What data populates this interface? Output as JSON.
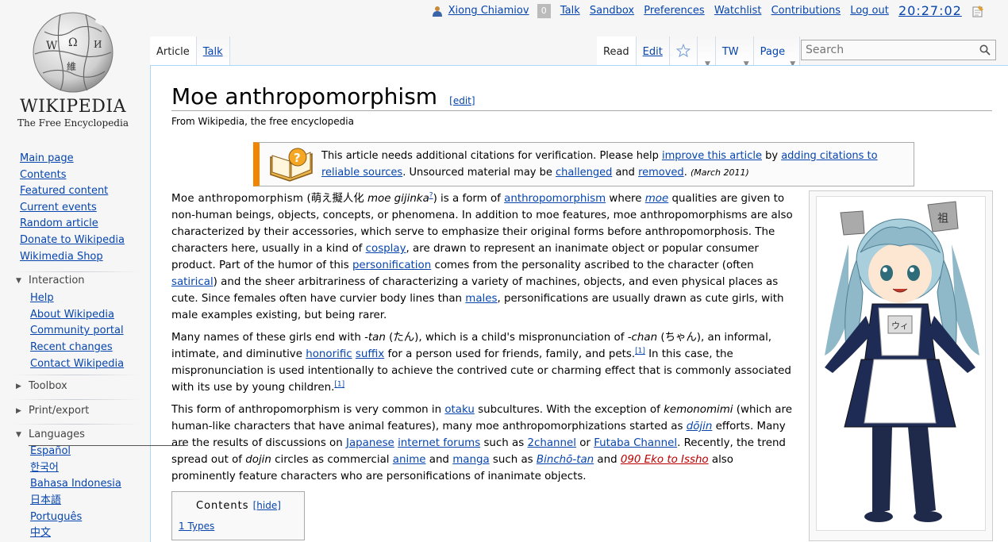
{
  "logo": {
    "wordmark": "WIKIPEDIA",
    "tagline": "The Free Encyclopedia"
  },
  "nav": [
    "Main page",
    "Contents",
    "Featured content",
    "Current events",
    "Random article",
    "Donate to Wikipedia",
    "Wikimedia Shop"
  ],
  "interaction": {
    "heading": "Interaction",
    "items": [
      "Help",
      "About Wikipedia",
      "Community portal",
      "Recent changes",
      "Contact Wikipedia"
    ]
  },
  "toolbox": {
    "heading": "Toolbox"
  },
  "print": {
    "heading": "Print/export"
  },
  "languages": {
    "heading": "Languages",
    "items": [
      "Español",
      "한국어",
      "Bahasa Indonesia",
      "日本語",
      "Português",
      "中文"
    ]
  },
  "personal": {
    "username": "Xiong Chiamiov",
    "count": "0",
    "talk": "Talk",
    "sandbox": "Sandbox",
    "preferences": "Preferences",
    "watchlist": "Watchlist",
    "contributions": "Contributions",
    "logout": "Log out",
    "clock": "20:27:02"
  },
  "tabs": {
    "article": "Article",
    "talk": "Talk",
    "read": "Read",
    "edit": "Edit",
    "tw": "TW",
    "page": "Page"
  },
  "search": {
    "placeholder": "Search"
  },
  "article": {
    "title": "Moe anthropomorphism",
    "edit": "[edit]",
    "sitesub": "From Wikipedia, the free encyclopedia",
    "ambox": {
      "t1": "This article needs additional citations for verification. Please help ",
      "l1": "improve this article",
      "t2": " by ",
      "l2": "adding citations to reliable sources",
      "t3": ". Unsourced material may be ",
      "l3": "challenged",
      "t4": " and ",
      "l4": "removed",
      "t5": ". ",
      "date": "(March 2011)"
    },
    "p1": {
      "t1": "Moe anthropomorphism",
      "t2": " (萌え擬人化 ",
      "t3": "moe gijinka",
      "t4": "?",
      "t5": ") is a form of ",
      "l1": "anthropomorphism",
      "t6": " where ",
      "l2": "moe",
      "t7": " qualities are given to non-human beings, objects, concepts, or phenomena. In addition to moe features, moe anthropomorphisms are also characterized by their accessories, which serve to emphasize their original forms before anthropomorphosis. The characters here, usually in a kind of ",
      "l3": "cosplay",
      "t8": ", are drawn to represent an inanimate object or popular consumer product. Part of the humor of this ",
      "l4": "personification",
      "t9": " comes from the personality ascribed to the character (often ",
      "l5": "satirical",
      "t10": ") and the sheer arbitrariness of characterizing a variety of machines, objects, and even physical places as cute. Since females often have curvier body lines than ",
      "l6": "males",
      "t11": ", personifications are usually drawn as cute girls, with male examples existing, but being rarer."
    },
    "p2": {
      "t1": "Many names of these girls end with ",
      "t2": "-tan",
      "t3": " (たん), which is a child's mispronunciation of ",
      "t4": "-chan",
      "t5": " (ちゃん), an informal, intimate, and diminutive ",
      "l1": "honorific",
      "t6": " ",
      "l2": "suffix",
      "t7": " for a person used for friends, family, and pets.",
      "ref1": "[1]",
      "t8": " In this case, the mispronunciation is used intentionally to achieve the contrived cute or charming effect that is commonly associated with its use by young children.",
      "ref2": "[1]"
    },
    "p3": {
      "t1": "This form of anthropomorphism is very common in ",
      "l1": "otaku",
      "t2": " subcultures. With the exception of ",
      "t3": "kemonomimi",
      "t4": " (which are human-like characters that have animal features), many moe anthropomorphizations started as ",
      "l2": "dōjin",
      "t5": " efforts. Many are the results of discussions on ",
      "l3": "Japanese",
      "t6": " ",
      "l4": "internet forums",
      "t7": " such as ",
      "l5": "2channel",
      "t8": " or ",
      "l6": "Futaba Channel",
      "t9": ". Recently, the trend spread out of ",
      "t10": "dojin",
      "t11": " circles as commercial ",
      "l7": "anime",
      "t12": " and ",
      "l8": "manga",
      "t13": " such as ",
      "l9": "Binchō-tan",
      "t14": " and ",
      "l10": "090 Eko to Issho",
      "t15": " also prominently feature characters who are personifications of inanimate objects."
    },
    "toc": {
      "title": "Contents",
      "hide": "[hide]",
      "item1": "1 Types"
    }
  },
  "colors": {
    "link": "#0645ad",
    "redlink": "#ba0000",
    "ambox_border": "#f28500"
  }
}
